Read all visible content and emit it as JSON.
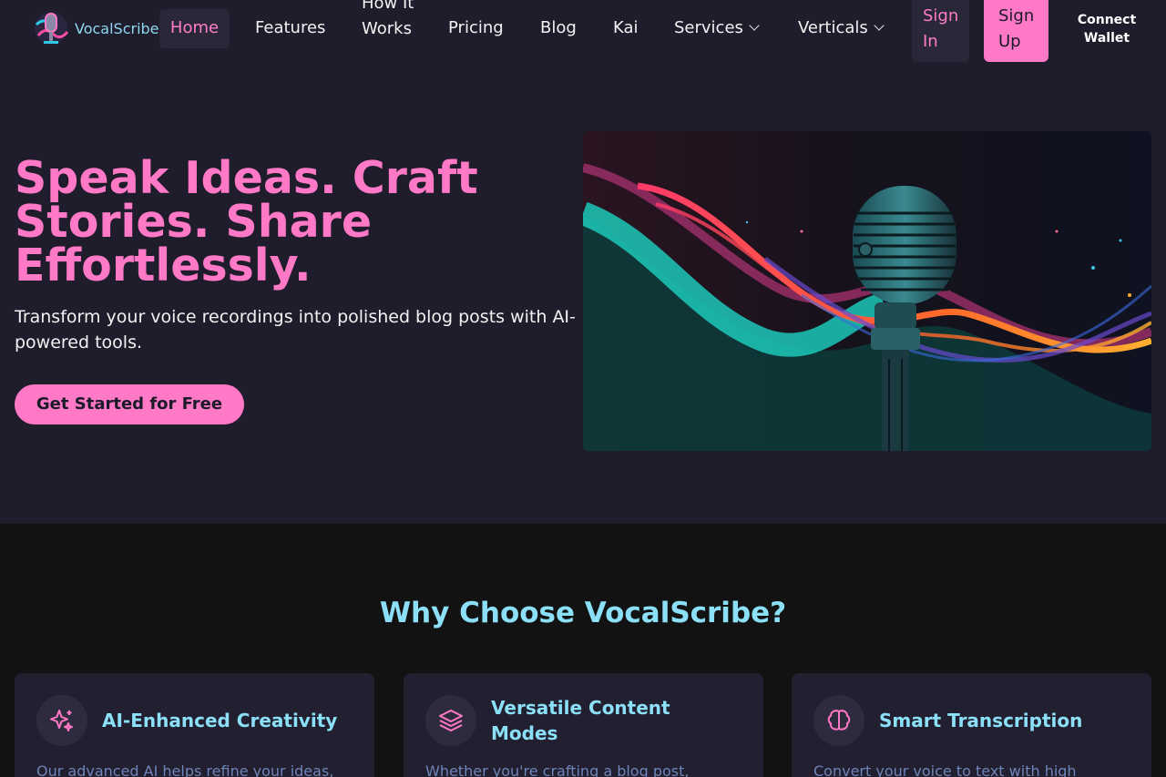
{
  "brand": {
    "name": "VocalScribe"
  },
  "nav": {
    "home": "Home",
    "features": "Features",
    "how_it_works": "How It Works",
    "pricing": "Pricing",
    "blog": "Blog",
    "kai": "Kai",
    "services": "Services",
    "verticals": "Verticals",
    "sign_in": "Sign In",
    "sign_up": "Sign Up",
    "connect_wallet": "Connect Wallet"
  },
  "hero": {
    "title": "Speak Ideas. Craft Stories. Share Effortlessly.",
    "subtitle": "Transform your voice recordings into polished blog posts with AI-powered tools.",
    "cta": "Get Started for Free"
  },
  "features": {
    "title": "Why Choose VocalScribe?",
    "cards": [
      {
        "icon": "sparkles-icon",
        "title": "AI-Enhanced Creativity",
        "desc": "Our advanced AI helps refine your ideas,"
      },
      {
        "icon": "layers-icon",
        "title": "Versatile Content Modes",
        "desc": "Whether you're crafting a blog post,"
      },
      {
        "icon": "brain-icon",
        "title": "Smart Transcription",
        "desc": "Convert your voice to text with high"
      }
    ]
  },
  "colors": {
    "accent": "#ff79c6",
    "cyan": "#8be0f8",
    "bg": "#1f1c2c"
  }
}
